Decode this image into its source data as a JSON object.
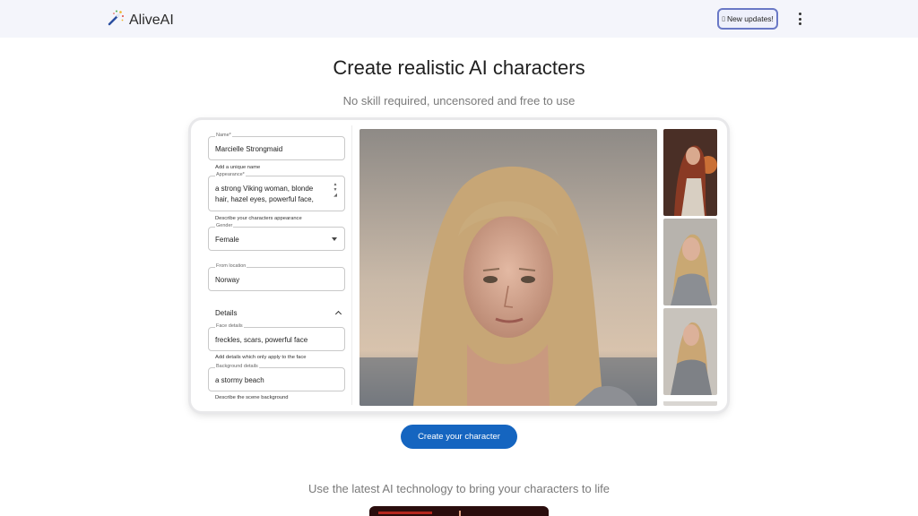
{
  "header": {
    "brand": "AliveAI",
    "updates_label": "New updates!",
    "updates_icon": "sparkle-glyph"
  },
  "hero": {
    "title": "Create realistic AI characters",
    "subtitle": "No skill required, uncensored and free to use"
  },
  "form": {
    "name": {
      "label": "Name*",
      "value": "Marcielle Strongmaid",
      "helper": "Add a unique name"
    },
    "appearance": {
      "label": "Appearance*",
      "value": "a strong Viking woman, blonde hair, hazel eyes, powerful face,",
      "helper": "Describe your characters appearance"
    },
    "gender": {
      "label": "Gender",
      "value": "Female"
    },
    "location": {
      "label": "From location",
      "value": "Norway"
    },
    "details": {
      "label": "Details"
    },
    "face": {
      "label": "Face details",
      "value": "freckles, scars, powerful face",
      "helper": "Add details which only apply to the face"
    },
    "background": {
      "label": "Background details",
      "value": "a stormy beach",
      "helper": "Describe the scene background"
    }
  },
  "cta": {
    "label": "Create your character"
  },
  "section": {
    "tagline": "Use the latest AI technology to bring your characters to life"
  },
  "colors": {
    "accent": "#1565c0",
    "topbar": "#f4f5fb",
    "updates_border": "#6a79c6"
  }
}
